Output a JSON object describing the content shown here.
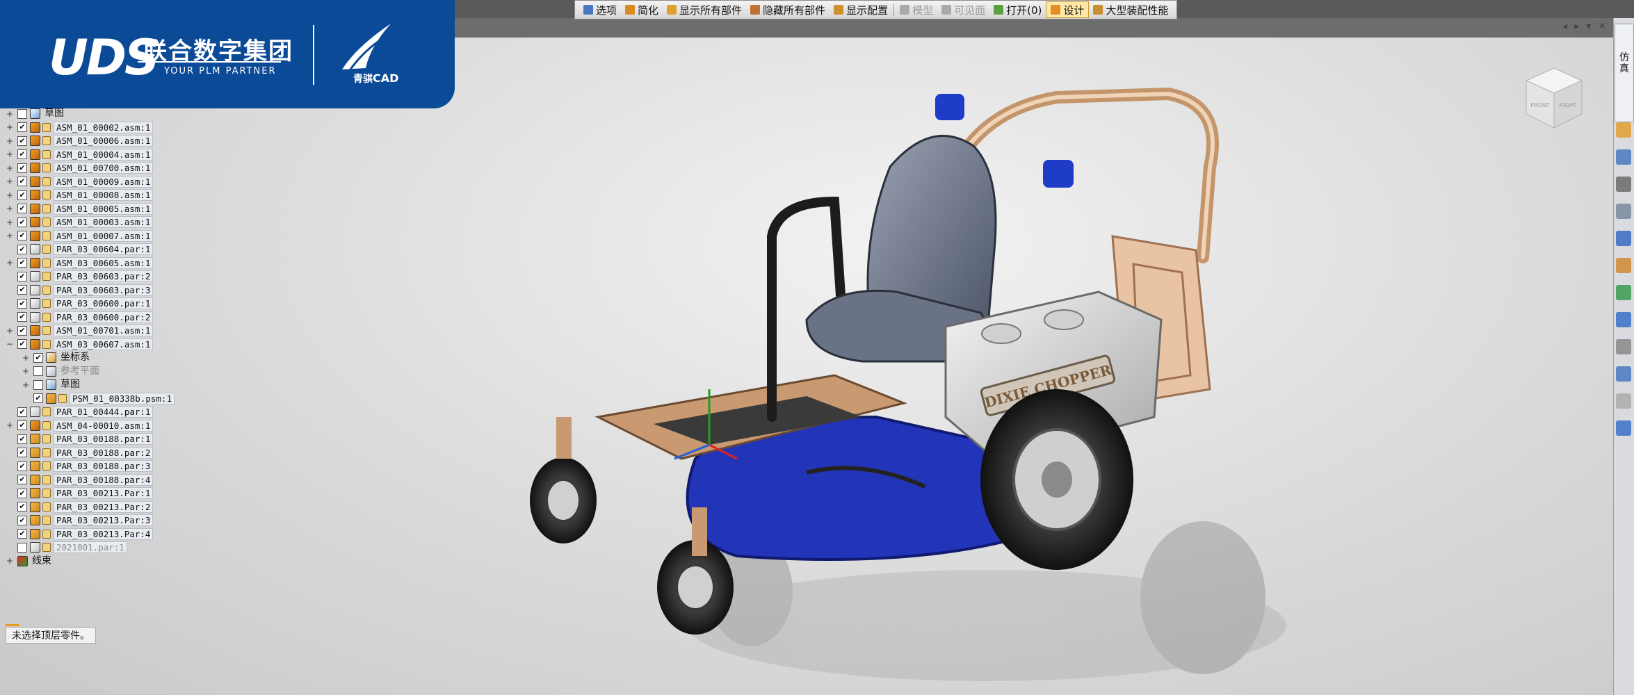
{
  "toolbar": {
    "items": [
      {
        "label": "选项",
        "icon": "options-icon",
        "state": "normal",
        "color": "#4a78c0"
      },
      {
        "label": "简化",
        "icon": "simplify-icon",
        "state": "normal",
        "color": "#d98a20"
      },
      {
        "label": "显示所有部件",
        "icon": "show-all-parts-icon",
        "state": "normal",
        "color": "#e0a030"
      },
      {
        "label": "隐藏所有部件",
        "icon": "hide-all-parts-icon",
        "state": "normal",
        "color": "#c07030"
      },
      {
        "label": "显示配置",
        "icon": "display-config-icon",
        "state": "normal",
        "color": "#d09030"
      },
      {
        "label": "模型",
        "icon": "model-icon",
        "state": "disabled",
        "color": "#aaaaaa"
      },
      {
        "label": "可见面",
        "icon": "visible-faces-icon",
        "state": "disabled",
        "color": "#aaaaaa"
      },
      {
        "label": "打开(0)",
        "icon": "open-icon",
        "state": "normal",
        "color": "#5aa040"
      },
      {
        "label": "设计",
        "icon": "design-icon",
        "state": "active",
        "color": "#e09020"
      },
      {
        "label": "大型装配性能",
        "icon": "large-assembly-icon",
        "state": "normal",
        "color": "#c89030"
      }
    ]
  },
  "window_controls": [
    "◂",
    "▸",
    "▾",
    "✕"
  ],
  "logo": {
    "brand": "UDS",
    "company": "联合数字集团",
    "tagline": "YOUR PLM PARTNER",
    "product_cn": "青骐",
    "product": "CAD",
    "bg_color": "#0b4a97"
  },
  "tree": [
    {
      "level": 0,
      "expand": "+",
      "checked": false,
      "type": "sk",
      "label": "草图",
      "dim": false,
      "cn": true
    },
    {
      "level": 0,
      "expand": "+",
      "checked": true,
      "type": "asm",
      "label": "ASM_01_00002.asm:1"
    },
    {
      "level": 0,
      "expand": "+",
      "checked": true,
      "type": "asm",
      "label": "ASM_01_00006.asm:1"
    },
    {
      "level": 0,
      "expand": "+",
      "checked": true,
      "type": "asm",
      "label": "ASM_01_00004.asm:1"
    },
    {
      "level": 0,
      "expand": "+",
      "checked": true,
      "type": "asm",
      "label": "ASM_01_00700.asm:1"
    },
    {
      "level": 0,
      "expand": "+",
      "checked": true,
      "type": "asm",
      "label": "ASM_01_00009.asm:1"
    },
    {
      "level": 0,
      "expand": "+",
      "checked": true,
      "type": "asm",
      "label": "ASM_01_00008.asm:1"
    },
    {
      "level": 0,
      "expand": "+",
      "checked": true,
      "type": "asm",
      "label": "ASM_01_00005.asm:1"
    },
    {
      "level": 0,
      "expand": "+",
      "checked": true,
      "type": "asm",
      "label": "ASM_01_00003.asm:1"
    },
    {
      "level": 0,
      "expand": "+",
      "checked": true,
      "type": "asm",
      "label": "ASM_01_00007.asm:1"
    },
    {
      "level": 0,
      "expand": "",
      "checked": true,
      "type": "par",
      "label": "PAR_03_00604.par:1"
    },
    {
      "level": 0,
      "expand": "+",
      "checked": true,
      "type": "asm",
      "label": "ASM_03_00605.asm:1"
    },
    {
      "level": 0,
      "expand": "",
      "checked": true,
      "type": "par",
      "label": "PAR_03_00603.par:2"
    },
    {
      "level": 0,
      "expand": "",
      "checked": true,
      "type": "par",
      "label": "PAR_03_00603.par:3"
    },
    {
      "level": 0,
      "expand": "",
      "checked": true,
      "type": "par",
      "label": "PAR_03_00600.par:1"
    },
    {
      "level": 0,
      "expand": "",
      "checked": true,
      "type": "par",
      "label": "PAR_03_00600.par:2"
    },
    {
      "level": 0,
      "expand": "+",
      "checked": true,
      "type": "asm",
      "label": "ASM_01_00701.asm:1"
    },
    {
      "level": 0,
      "expand": "−",
      "checked": true,
      "type": "asm",
      "label": "ASM_03_00607.asm:1"
    },
    {
      "level": 1,
      "expand": "+",
      "checked": true,
      "type": "coord",
      "label": "坐标系",
      "cn": true
    },
    {
      "level": 1,
      "expand": "+",
      "checked": false,
      "type": "plane",
      "label": "参考平面",
      "cn": true,
      "dim": true
    },
    {
      "level": 1,
      "expand": "+",
      "checked": false,
      "type": "sk",
      "label": "草图",
      "cn": true
    },
    {
      "level": 1,
      "expand": "",
      "checked": true,
      "type": "psm",
      "label": "PSM_01_00338b.psm:1"
    },
    {
      "level": 0,
      "expand": "",
      "checked": true,
      "type": "par",
      "label": "PAR_01_00444.par:1"
    },
    {
      "level": 0,
      "expand": "+",
      "checked": true,
      "type": "asm",
      "label": "ASM_04-00010.asm:1"
    },
    {
      "level": 0,
      "expand": "",
      "checked": true,
      "type": "psm",
      "label": "PAR_03_00188.par:1"
    },
    {
      "level": 0,
      "expand": "",
      "checked": true,
      "type": "psm",
      "label": "PAR_03_00188.par:2"
    },
    {
      "level": 0,
      "expand": "",
      "checked": true,
      "type": "psm",
      "label": "PAR_03_00188.par:3"
    },
    {
      "level": 0,
      "expand": "",
      "checked": true,
      "type": "psm",
      "label": "PAR_03_00188.par:4"
    },
    {
      "level": 0,
      "expand": "",
      "checked": true,
      "type": "psm",
      "label": "PAR_03_00213.Par:1"
    },
    {
      "level": 0,
      "expand": "",
      "checked": true,
      "type": "psm",
      "label": "PAR_03_00213.Par:2"
    },
    {
      "level": 0,
      "expand": "",
      "checked": true,
      "type": "psm",
      "label": "PAR_03_00213.Par:3"
    },
    {
      "level": 0,
      "expand": "",
      "checked": true,
      "type": "psm",
      "label": "PAR_03_00213.Par:4"
    },
    {
      "level": 0,
      "expand": "",
      "checked": false,
      "type": "par",
      "label": "2021001.par:1",
      "dim": true
    },
    {
      "level": 0,
      "expand": "+",
      "checked": null,
      "type": "wire",
      "label": "线束",
      "cn": true
    }
  ],
  "status": {
    "text": "未选择顶层零件。"
  },
  "right_strip": {
    "tab_label": "仿真",
    "icons": [
      "color-palette-icon",
      "view-icon",
      "screen-capture-icon",
      "wrench-icon",
      "parts-library-icon",
      "assembly-icon",
      "materials-icon",
      "help-icon",
      "grid-icon",
      "layers-icon",
      "comment-icon",
      "settings-icon"
    ]
  },
  "viewport": {
    "hood_text": "DIXIE CHOPPER",
    "navcube_faces": [
      "FRONT",
      "RIGHT"
    ]
  }
}
